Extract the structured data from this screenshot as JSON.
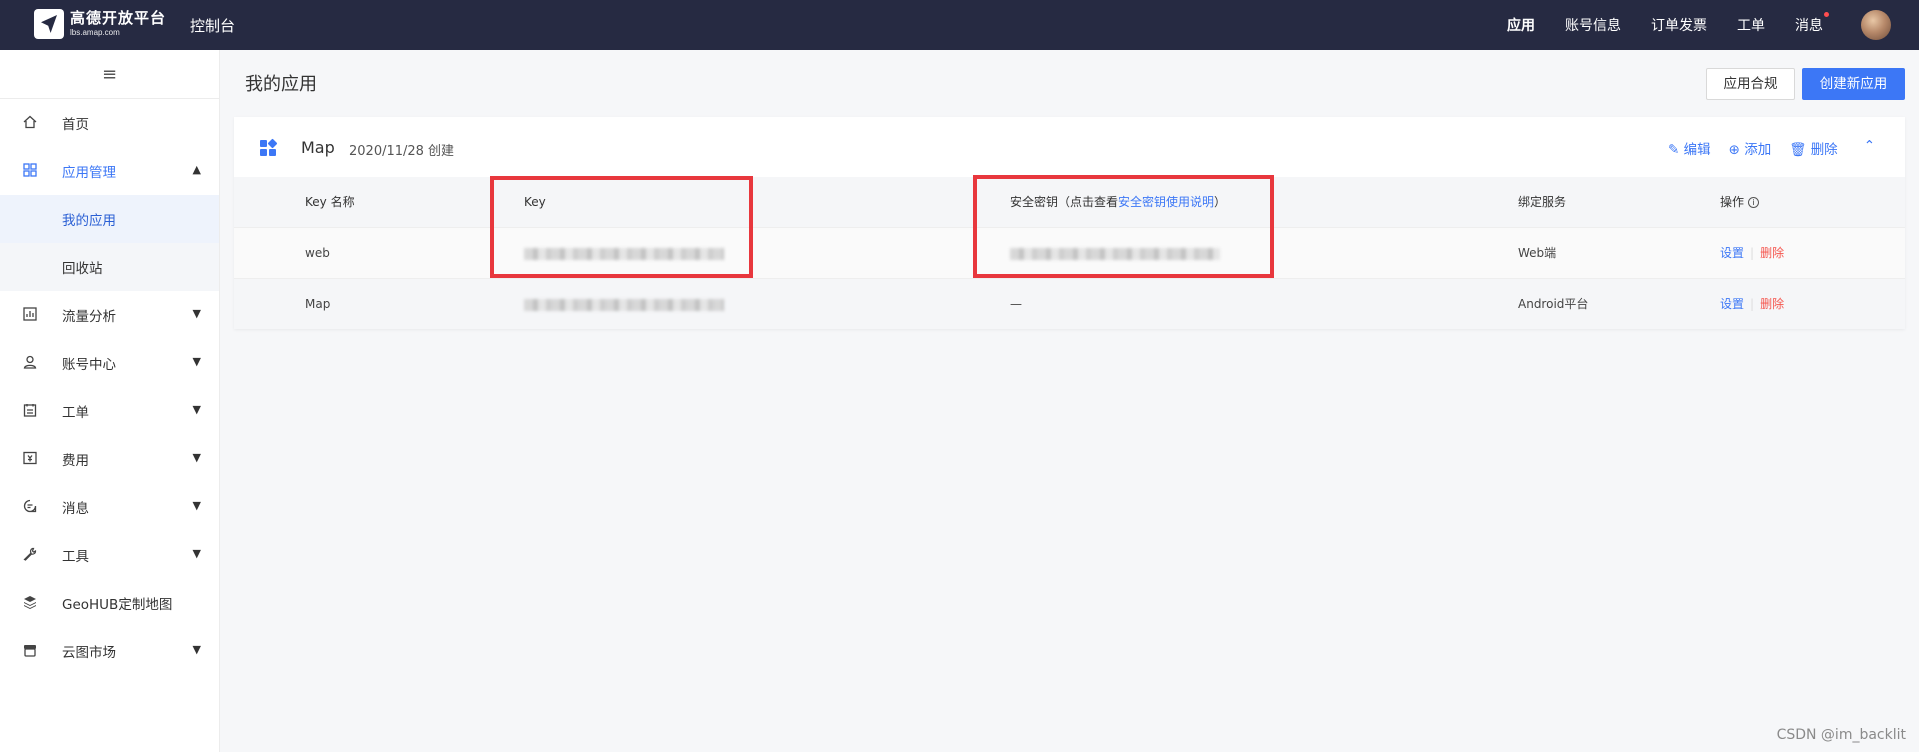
{
  "header": {
    "logo_title": "高德开放平台",
    "logo_sub": "lbs.amap.com",
    "console": "控制台",
    "nav": [
      "应用",
      "账号信息",
      "订单发票",
      "工单",
      "消息"
    ]
  },
  "sidebar": {
    "toggle": "≡",
    "items": [
      {
        "label": "首页",
        "icon": "home-icon"
      },
      {
        "label": "应用管理",
        "icon": "apps-icon"
      },
      {
        "label": "我的应用"
      },
      {
        "label": "回收站"
      },
      {
        "label": "流量分析",
        "icon": "chart-icon"
      },
      {
        "label": "账号中心",
        "icon": "user-icon"
      },
      {
        "label": "工单",
        "icon": "ticket-icon"
      },
      {
        "label": "费用",
        "icon": "money-icon"
      },
      {
        "label": "消息",
        "icon": "message-icon"
      },
      {
        "label": "工具",
        "icon": "wrench-icon"
      },
      {
        "label": "GeoHUB定制地图",
        "icon": "layers-icon"
      },
      {
        "label": "云图市场",
        "icon": "store-icon"
      }
    ]
  },
  "main": {
    "title": "我的应用",
    "btn_compliance": "应用合规",
    "btn_create": "创建新应用",
    "app": {
      "name": "Map",
      "created": "2020/11/28 创建",
      "actions": {
        "edit": "编辑",
        "add": "添加",
        "delete": "删除"
      }
    },
    "table": {
      "headers": {
        "keyname": "Key 名称",
        "key": "Key",
        "secret_prefix": "安全密钥（点击查看",
        "secret_link": "安全密钥使用说明",
        "secret_suffix": "）",
        "service": "绑定服务",
        "ops": "操作"
      },
      "rows": [
        {
          "name": "web",
          "secret": "",
          "service": "Web端",
          "set": "设置",
          "del": "删除"
        },
        {
          "name": "Map",
          "secret": "—",
          "service": "Android平台",
          "set": "设置",
          "del": "删除"
        }
      ]
    }
  },
  "watermark": "CSDN @im_backlit",
  "colors": {
    "accent": "#3c77f6",
    "danger": "#f5554d",
    "topbar": "#262a42",
    "highlight": "#e8373d"
  }
}
